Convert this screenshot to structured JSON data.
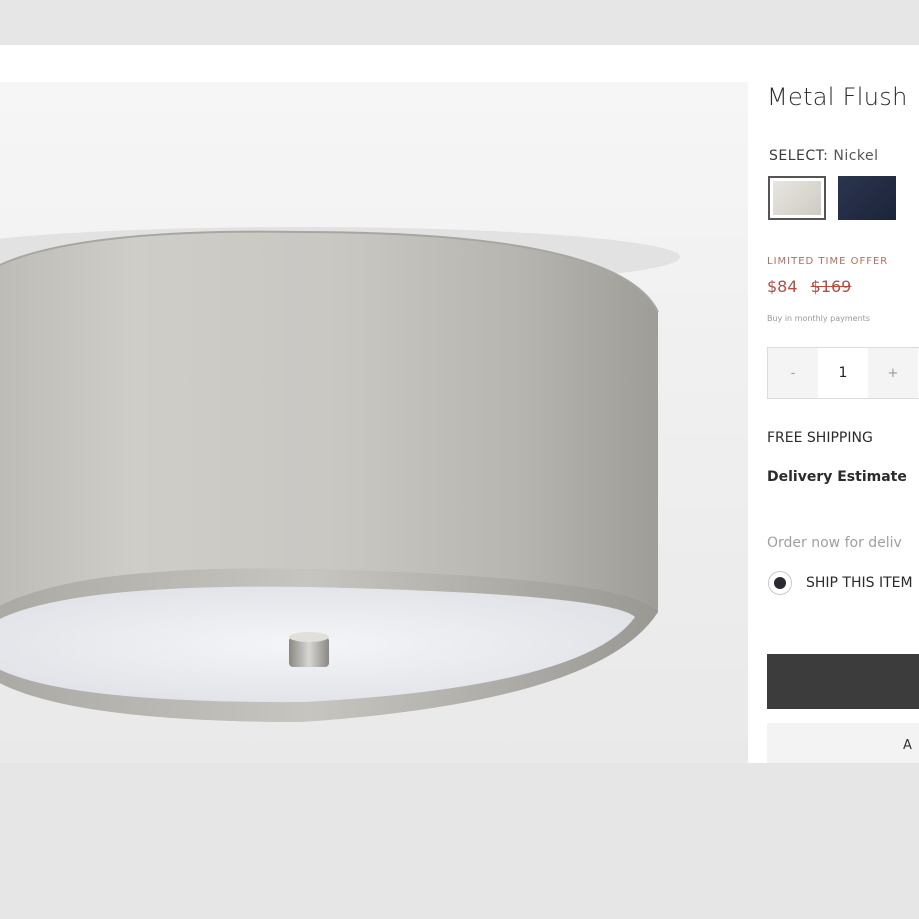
{
  "product": {
    "title": "Metal Flush",
    "select_label": "SELECT:",
    "select_value": "Nickel",
    "swatches": [
      {
        "name": "Nickel",
        "color": "#d9d5cf",
        "selected": true
      },
      {
        "name": "Navy",
        "color": "#232c44",
        "selected": false
      }
    ]
  },
  "pricing": {
    "offer_label": "LIMITED TIME OFFER",
    "price_now": "$84",
    "price_was": "$169",
    "monthly_text": "Buy in monthly payments"
  },
  "quantity": {
    "minus_label": "-",
    "value": "1",
    "plus_label": "+"
  },
  "shipping": {
    "free_label": "FREE SHIPPING",
    "delivery_heading": "Delivery Estimate",
    "order_text": "Order now for deliv",
    "ship_option_label": "SHIP THIS ITEM"
  },
  "actions": {
    "secondary_label": "A"
  },
  "colors": {
    "accent_price": "#b05044",
    "button_dark": "#3c3c3c",
    "background": "#e6e6e6"
  }
}
